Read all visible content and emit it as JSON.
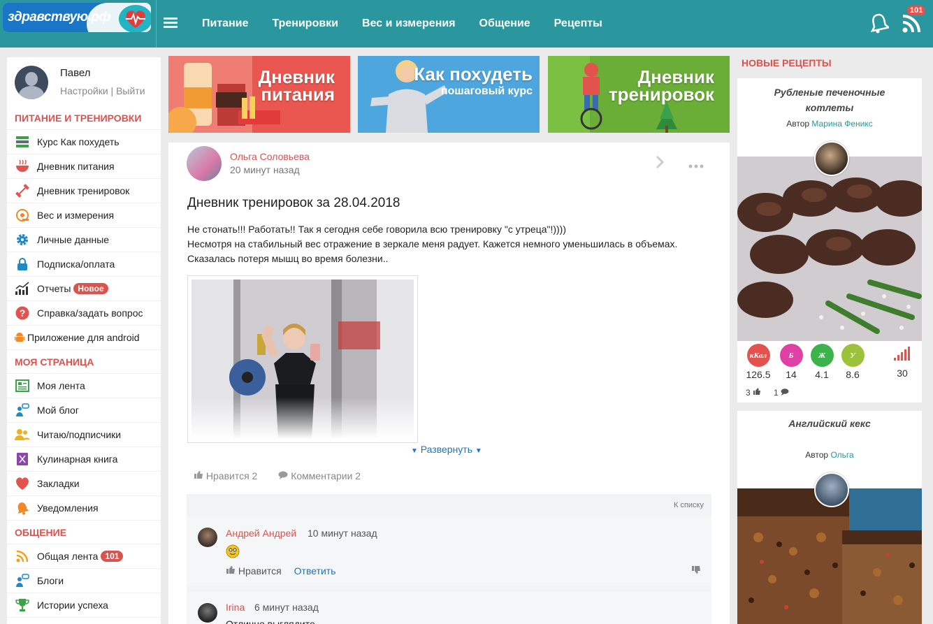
{
  "header": {
    "logo_text": "здравствую.рф",
    "nav": [
      "Питание",
      "Тренировки",
      "Вес и измерения",
      "Общение",
      "Рецепты"
    ],
    "feed_badge": "101"
  },
  "profile": {
    "name": "Павел",
    "settings": "Настройки",
    "separator": " | ",
    "logout": "Выйти"
  },
  "sidebar": {
    "sections": [
      {
        "title": "ПИТАНИЕ И ТРЕНИРОВКИ",
        "items": [
          {
            "label": "Курс Как похудеть",
            "icon": "books-icon"
          },
          {
            "label": "Дневник питания",
            "icon": "bowl-icon"
          },
          {
            "label": "Дневник тренировок",
            "icon": "dumbbell-icon"
          },
          {
            "label": "Вес и измерения",
            "icon": "tape-measure-icon"
          },
          {
            "label": "Личные данные",
            "icon": "gear-icon"
          },
          {
            "label": "Подписка/оплата",
            "icon": "lock-icon"
          },
          {
            "label": "Отчеты",
            "icon": "chart-icon",
            "badge": "Новое"
          },
          {
            "label": "Справка/задать вопрос",
            "icon": "question-icon"
          },
          {
            "label": "Приложение для android",
            "icon": "android-icon"
          }
        ]
      },
      {
        "title": "МОЯ СТРАНИЦА",
        "items": [
          {
            "label": "Моя лента",
            "icon": "feed-icon"
          },
          {
            "label": "Мой блог",
            "icon": "blog-icon"
          },
          {
            "label": "Читаю/подписчики",
            "icon": "users-icon"
          },
          {
            "label": "Кулинарная книга",
            "icon": "cookbook-icon"
          },
          {
            "label": "Закладки",
            "icon": "heart-icon"
          },
          {
            "label": "Уведомления",
            "icon": "bell-icon"
          }
        ]
      },
      {
        "title": "ОБЩЕНИЕ",
        "items": [
          {
            "label": "Общая лента",
            "icon": "rss-icon",
            "badge": "101"
          },
          {
            "label": "Блоги",
            "icon": "blogs-icon"
          },
          {
            "label": "Истории успеха",
            "icon": "trophy-icon"
          }
        ]
      }
    ]
  },
  "banners": [
    {
      "line1": "Дневник",
      "line2": "питания"
    },
    {
      "line1": "Как похудеть",
      "line2": "пошаговый курс"
    },
    {
      "line1": "Дневник",
      "line2": "тренировок"
    }
  ],
  "post": {
    "author": "Ольга Соловьева",
    "time": "20 минут назад",
    "title": "Дневник тренировок за 28.04.2018",
    "text_line1": "Не стонать!!! Работать!! Так я сегодня себе говорила всю тренировку \"с утреца\"!))))",
    "text_line2": "Несмотря на стабильный вес отражение в зеркале меня радует. Кажется немного уменьшилась в объемах. Сказалась потеря мышц во время болезни..",
    "expand": "Развернуть",
    "likes": "Нравится 2",
    "comments": "Комментарии 2",
    "to_list": "К списку"
  },
  "comments": [
    {
      "author": "Андрей Андрей",
      "time": "10 минут назад",
      "text": "",
      "like": "Нравится",
      "reply": "Ответить"
    },
    {
      "author": "Irina",
      "time": "6 минут назад",
      "text": "Отлично выглядите"
    }
  ],
  "right": {
    "title": "НОВЫЕ РЕЦЕПТЫ",
    "recipes": [
      {
        "title": "Рубленые печеночные котлеты",
        "author_prefix": "Автор ",
        "author": "Марина Феникс",
        "nutrition": [
          {
            "label": "кКал",
            "value": "126.5",
            "color": "#e2534d"
          },
          {
            "label": "Б",
            "value": "14",
            "color": "#e03fa6"
          },
          {
            "label": "Ж",
            "value": "4.1",
            "color": "#3bb34a"
          },
          {
            "label": "У",
            "value": "8.6",
            "color": "#9cc13a"
          }
        ],
        "rating": "30",
        "likes": "3",
        "comments": "1"
      },
      {
        "title": "Английский кекс",
        "author_prefix": "Автор ",
        "author": "Ольга"
      }
    ]
  }
}
